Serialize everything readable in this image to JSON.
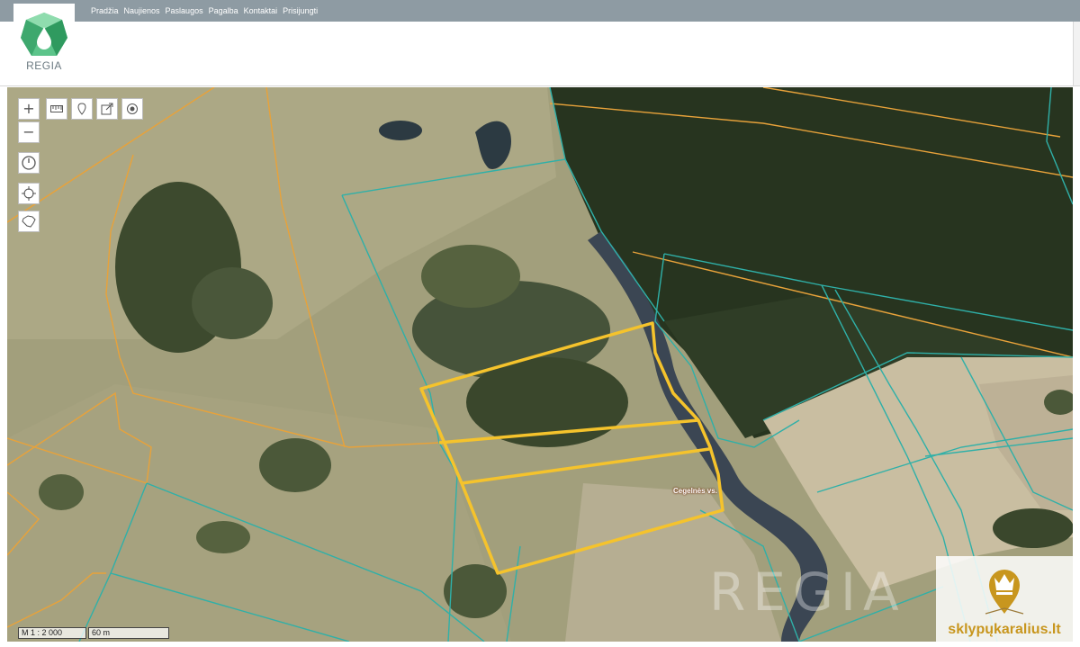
{
  "nav": {
    "items": [
      "Pradžia",
      "Naujienos",
      "Paslaugos",
      "Pagalba",
      "Kontaktai",
      "Prisijungti"
    ]
  },
  "logo": {
    "text": "REGIA",
    "icon": "regia-gem-icon"
  },
  "map": {
    "place_label": "Cegelnės vs.",
    "scale_ratio": "M 1 : 2 000",
    "scale_length": "60 m",
    "watermark": "REGIA",
    "controls": {
      "zoom_in": "+",
      "zoom_out": "−",
      "toolbar_icons": [
        "ruler-icon",
        "marker-icon",
        "export-icon",
        "target-icon"
      ],
      "side_icons": [
        "clock-icon",
        "locate-icon",
        "lithuania-map-icon"
      ]
    }
  },
  "brand": {
    "text": "sklypųkaralius.lt",
    "icon": "crown-pin-icon"
  },
  "colors": {
    "topbar": "#8e9ba3",
    "parcel_orange": "#e8a23a",
    "parcel_teal": "#2fb0a8",
    "selected_parcel": "#f5c32c",
    "brand": "#c8961e"
  }
}
